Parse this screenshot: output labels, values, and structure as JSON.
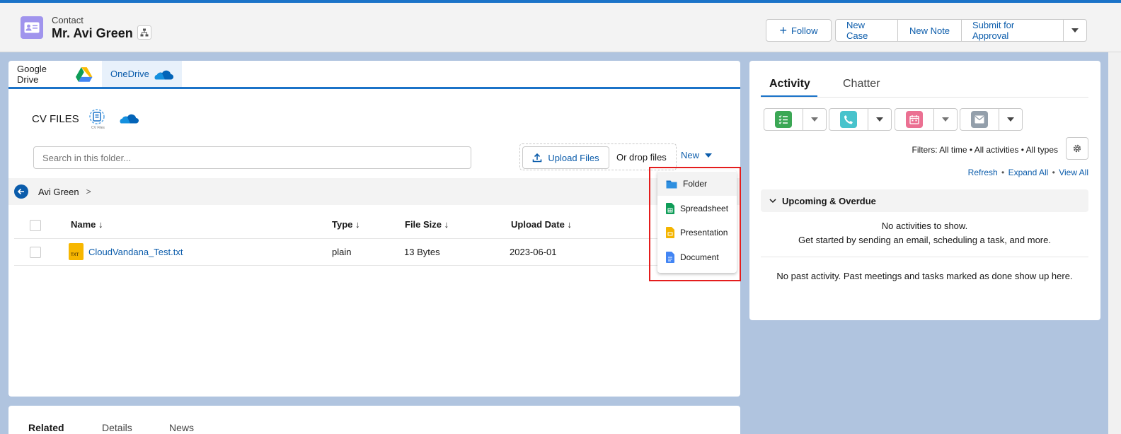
{
  "record": {
    "object_type": "Contact",
    "name": "Mr. Avi Green"
  },
  "header_actions": {
    "follow": "Follow",
    "new_case": "New Case",
    "new_note": "New Note",
    "submit_for_approval": "Submit for Approval"
  },
  "cloud_tabs": [
    {
      "label": "Google Drive"
    },
    {
      "label": "OneDrive"
    }
  ],
  "files": {
    "title": "CV FILES",
    "logo_caption": "CV Files",
    "search_placeholder": "Search in this folder...",
    "upload_label": "Upload Files",
    "drop_label": "Or drop files",
    "new_label": "New",
    "breadcrumb": {
      "folder": "Avi Green",
      "separator": ">"
    },
    "columns": [
      "Name",
      "Type",
      "File Size",
      "Upload Date"
    ],
    "sort_arrow": "↓",
    "rows": [
      {
        "name": "CloudVandana_Test.txt",
        "icon_label": "TXT",
        "type": "plain",
        "size": "13 Bytes",
        "date": "2023-06-01"
      }
    ],
    "new_menu": [
      "Folder",
      "Spreadsheet",
      "Presentation",
      "Document"
    ]
  },
  "bottom_tabs": [
    "Related",
    "Details",
    "News"
  ],
  "activity": {
    "tabs": [
      "Activity",
      "Chatter"
    ],
    "filters_text": "Filters: All time • All activities • All types",
    "links": {
      "refresh": "Refresh",
      "expand_all": "Expand All",
      "view_all": "View All",
      "separator": "•"
    },
    "section_title": "Upcoming & Overdue",
    "empty_line1": "No activities to show.",
    "empty_line2": "Get started by sending an email, scheduling a task, and more.",
    "past_text": "No past activity. Past meetings and tasks marked as done show up here."
  },
  "colors": {
    "brand_blue": "#1b73c8",
    "link_blue": "#0b5cab",
    "contact_icon": "#a094ed",
    "task_green": "#3ba755",
    "call_teal": "#48c3cc",
    "event_pink": "#eb7092",
    "email_gray": "#939fab",
    "highlight_red": "#e41d1d"
  }
}
